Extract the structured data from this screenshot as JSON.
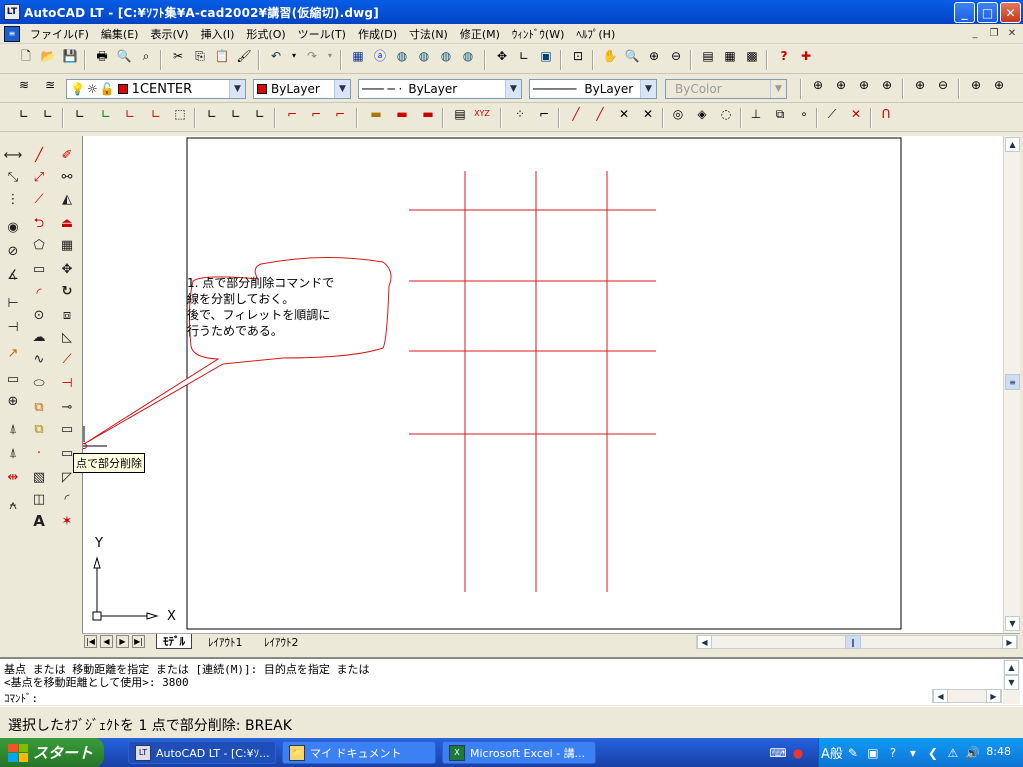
{
  "window": {
    "title": "AutoCAD LT - [C:¥ｿﾌﾄ集¥A-cad2002¥講習(仮縮切).dwg]",
    "app_icon": "LT"
  },
  "menu": {
    "items": [
      "ファイル(F)",
      "編集(E)",
      "表示(V)",
      "挿入(I)",
      "形式(O)",
      "ツール(T)",
      "作成(D)",
      "寸法(N)",
      "修正(M)",
      "ｳｨﾝﾄﾞｳ(W)",
      "ﾍﾙﾌﾟ(H)"
    ]
  },
  "properties": {
    "layer": "1CENTER",
    "color": "ByLayer",
    "linetype": "ByLayer",
    "lineweight": "ByLayer",
    "plotstyle": "ByColor",
    "color_swatch": "#e00000"
  },
  "drawing": {
    "line_color": "#d81818",
    "callout_text": [
      "1. 点で部分削除コマンドで",
      "線を分割しておく。",
      "後で、フィレットを順調に",
      "行うためである。"
    ],
    "tooltip": "点で部分削除",
    "ucs_x": "X",
    "ucs_y": "Y"
  },
  "layout_tabs": [
    "ﾓﾃﾞﾙ",
    "ﾚｲｱｳﾄ1",
    "ﾚｲｱｳﾄ2"
  ],
  "command": {
    "line1": "基点 または 移動距離を指定 または [連続(M)]: 目的点を指定 または",
    "line2": "<基点を移動距離として使用>: 3800",
    "prompt": "ｺﾏﾝﾄﾞ:"
  },
  "status": {
    "text": "選択したｵﾌﾞｼﾞｪｸﾄを 1 点で部分削除:  BREAK"
  },
  "taskbar": {
    "start": "スタート",
    "tasks": [
      "AutoCAD LT - [C:¥ｿ...",
      "マイ ドキュメント",
      "Microsoft Excel - 講..."
    ],
    "clock": "8:48",
    "ime": "A般"
  }
}
